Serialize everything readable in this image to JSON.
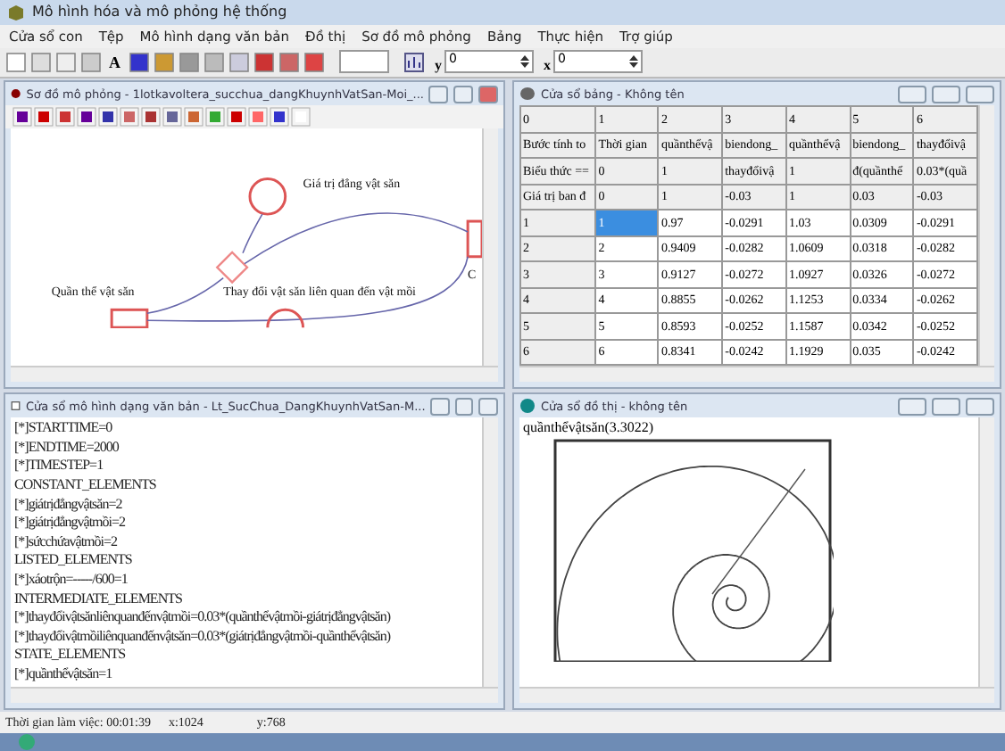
{
  "window": {
    "title": "Mô hình hóa và mô phỏng hệ thống"
  },
  "menu": [
    "Cửa sổ con",
    "Tệp",
    "Mô hình dạng văn bản",
    "Đồ thị",
    "Sơ đồ mô phỏng",
    "Bảng",
    "Thực hiện",
    "Trợ giúp"
  ],
  "toolbar": {
    "font_button": "A",
    "spin_fields": [
      {
        "label": "y",
        "value": "0"
      },
      {
        "label": "x",
        "value": "0"
      }
    ]
  },
  "diagram_window": {
    "title": "Sơ đồ mô phỏng - 1lotkavoltera_succhua_dangKhuynhVatSan-Moi_...",
    "labels": [
      "Giá trị đẳng vật săn",
      "Quần thể vật săn",
      "Thay đổi vật săn liên quan đến vật mồi",
      "C"
    ]
  },
  "table_window": {
    "title": "Cửa sổ bảng - Không tên",
    "columns": [
      "0",
      "1",
      "2",
      "3",
      "4",
      "5",
      "6"
    ],
    "header_rows": [
      [
        "Bước tính to",
        "Thời gian",
        "quầnthểvậ",
        "biendong_",
        "quầnthểvậ",
        "biendong_",
        "thayđổivậ"
      ],
      [
        "Biểu thức ==",
        "0",
        "1",
        "thayđổivậ",
        "1",
        "đ(quầnthể",
        "0.03*(quầ"
      ],
      [
        "Giá trị ban đ",
        "0",
        "1",
        "-0.03",
        "1",
        "0.03",
        "-0.03"
      ]
    ],
    "rows": [
      {
        "cells": [
          {
            "text": "1",
            "selected": false
          },
          {
            "text": "1",
            "selected": true
          },
          {
            "text": "0.97",
            "selected": false
          },
          {
            "text": "-0.0291",
            "selected": false
          },
          {
            "text": "1.03",
            "selected": false
          },
          {
            "text": "0.0309",
            "selected": false
          },
          {
            "text": "-0.0291",
            "selected": false
          }
        ]
      },
      {
        "cells": [
          {
            "text": "2",
            "selected": false
          },
          {
            "text": "2",
            "selected": false
          },
          {
            "text": "0.9409",
            "selected": false
          },
          {
            "text": "-0.0282",
            "selected": false
          },
          {
            "text": "1.0609",
            "selected": false
          },
          {
            "text": "0.0318",
            "selected": false
          },
          {
            "text": "-0.0282",
            "selected": false
          }
        ]
      },
      {
        "cells": [
          {
            "text": "3",
            "selected": false
          },
          {
            "text": "3",
            "selected": false
          },
          {
            "text": "0.9127",
            "selected": false
          },
          {
            "text": "-0.0272",
            "selected": false
          },
          {
            "text": "1.0927",
            "selected": false
          },
          {
            "text": "0.0326",
            "selected": false
          },
          {
            "text": "-0.0272",
            "selected": false
          }
        ]
      },
      {
        "cells": [
          {
            "text": "4",
            "selected": false
          },
          {
            "text": "4",
            "selected": false
          },
          {
            "text": "0.8855",
            "selected": false
          },
          {
            "text": "-0.0262",
            "selected": false
          },
          {
            "text": "1.1253",
            "selected": false
          },
          {
            "text": "0.0334",
            "selected": false
          },
          {
            "text": "-0.0262",
            "selected": false
          }
        ]
      },
      {
        "cells": [
          {
            "text": "5",
            "selected": false
          },
          {
            "text": "5",
            "selected": false
          },
          {
            "text": "0.8593",
            "selected": false
          },
          {
            "text": "-0.0252",
            "selected": false
          },
          {
            "text": "1.1587",
            "selected": false
          },
          {
            "text": "0.0342",
            "selected": false
          },
          {
            "text": "-0.0252",
            "selected": false
          }
        ]
      },
      {
        "cells": [
          {
            "text": "6",
            "selected": false
          },
          {
            "text": "6",
            "selected": false
          },
          {
            "text": "0.8341",
            "selected": false
          },
          {
            "text": "-0.0242",
            "selected": false
          },
          {
            "text": "1.1929",
            "selected": false
          },
          {
            "text": "0.035",
            "selected": false
          },
          {
            "text": "-0.0242",
            "selected": false
          }
        ]
      }
    ]
  },
  "text_window": {
    "title": "Cửa sổ mô hình dạng văn bản - Lt_SucChua_DangKhuynhVatSan-M...",
    "lines": [
      "[*]STARTTIME=0",
      "[*]ENDTIME=2000",
      "[*]TIMESTEP=1",
      "CONSTANT_ELEMENTS",
      "[*]giátrịđẳngvậtsăn=2",
      "[*]giátrịđẳngvậtmồi=2",
      "[*]sứcchứavậtmồi=2",
      "LISTED_ELEMENTS",
      "[*]xáotrộn=-----/600=1",
      "INTERMEDIATE_ELEMENTS",
      "[*]thayđổivậtsănliênquanđếnvậtmồi=0.03*(quầnthểvậtmồi-giátrịđẳngvậtsăn)",
      "[*]thayđổivậtmồiliênquanđếnvậtsăn=0.03*(giátrịđẳngvậtmồi-quầnthểvậtsăn)",
      "STATE_ELEMENTS",
      "[*]quầnthểvậtsăn=1"
    ]
  },
  "graph_window": {
    "title": "Cửa sổ đồ thị - không tên",
    "series_label": "quầnthểvậtsăn(3.3022)"
  },
  "status_bar": [
    "Thời gian làm việc: 00:01:39",
    "x:1024",
    "y:768"
  ]
}
